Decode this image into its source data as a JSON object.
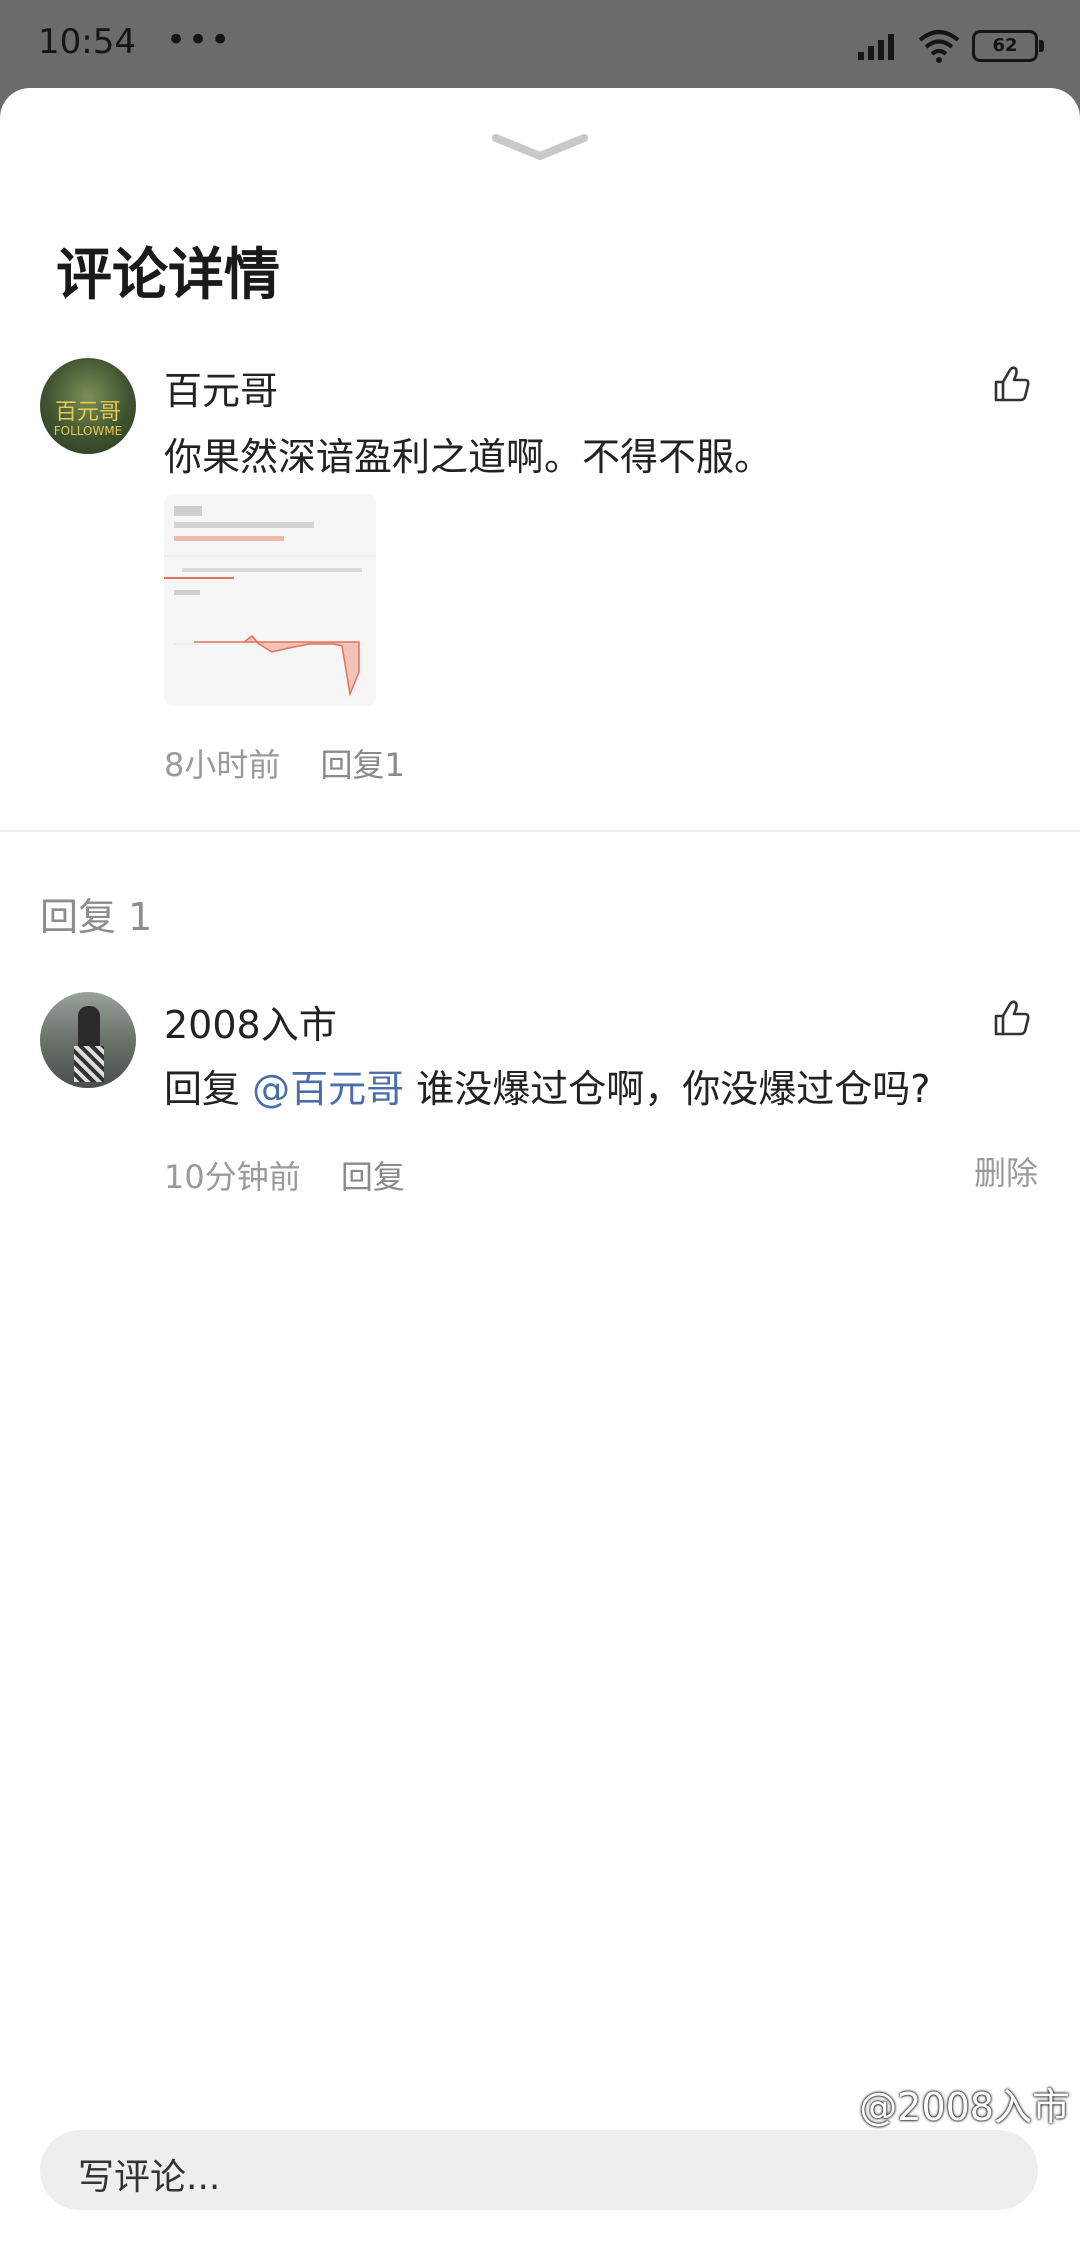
{
  "status_bar": {
    "time": "10:54",
    "more": "•••",
    "battery": "62"
  },
  "sheet": {
    "title": "评论详情"
  },
  "main_comment": {
    "author": "百元哥",
    "avatar_text": "百元哥",
    "avatar_sub": "FOLLOWME",
    "text": "你果然深谙盈利之道啊。不得不服。",
    "time": "8小时前",
    "reply_label": "回复1"
  },
  "replies_section": {
    "heading": "回复 1"
  },
  "reply": {
    "author": "2008入市",
    "prefix": "回复 ",
    "mention": "@百元哥",
    "text": " 谁没爆过仓啊，你没爆过仓吗?",
    "time": "10分钟前",
    "reply_label": "回复",
    "delete_label": "删除"
  },
  "input": {
    "placeholder": "写评论..."
  },
  "watermark": "@2008入市",
  "colors": {
    "mention": "#4a6ea9",
    "meta": "#9a9a9a",
    "accent_chart": "#e2725b"
  }
}
